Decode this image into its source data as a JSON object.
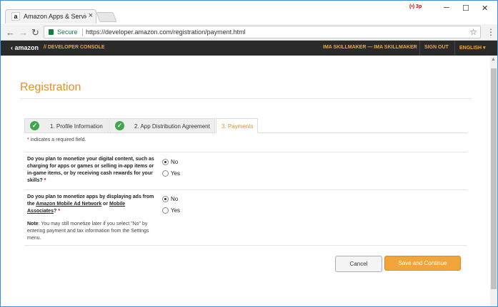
{
  "browser": {
    "tab_title": "Amazon Apps & Services",
    "tab_favicon": "a",
    "close_tab": "×",
    "extension_badge": "(•) 3p",
    "minimize": "─",
    "maximize": "☐",
    "close_window": "✕",
    "back": "←",
    "forward": "→",
    "reload": "↻",
    "secure_label": "Secure",
    "url": "https://developer.amazon.com/registration/payment.html",
    "bookmark_icon": "☆",
    "menu_icon": "⋮"
  },
  "header": {
    "logo": "‹ amazon",
    "console": "// DEVELOPER CONSOLE",
    "user": "IMA SKILLMAKER — IMA SKILLMAKER",
    "signout": "SIGN OUT",
    "language": "ENGLISH ▾"
  },
  "page": {
    "title": "Registration",
    "steps": [
      {
        "label": "1. Profile Information",
        "complete": true
      },
      {
        "label": "2. App Distribution Agreement",
        "complete": true
      },
      {
        "label": "3. Payments",
        "complete": false,
        "active": true
      }
    ],
    "check_glyph": "✓",
    "required_star": "*",
    "required_note": " indicates a required field.",
    "q1": {
      "text": "Do you plan to monetize your digital content, such as charging for apps or games or selling in-app items or in-game items, or by receiving cash rewards for your skills?",
      "options": [
        "No",
        "Yes"
      ],
      "selected": "No"
    },
    "q2": {
      "prefix": "Do you plan to monetize apps by displaying ads from the ",
      "link1": "Amazon Mobile Ad Network",
      "middle": " or ",
      "link2": "Mobile Associates",
      "suffix": "?",
      "options": [
        "No",
        "Yes"
      ],
      "selected": "No",
      "note_label": "Note",
      "note_text": ": You may still monetize later if you select \"No\" by entering payment and tax information from the Settings menu."
    },
    "cancel_label": "Cancel",
    "save_label": "Save and Continue"
  },
  "colors": {
    "accent": "#e58e26",
    "header_bg": "#2a2a2a",
    "save_button": "#f0a43a",
    "check": "#3fa64a"
  }
}
